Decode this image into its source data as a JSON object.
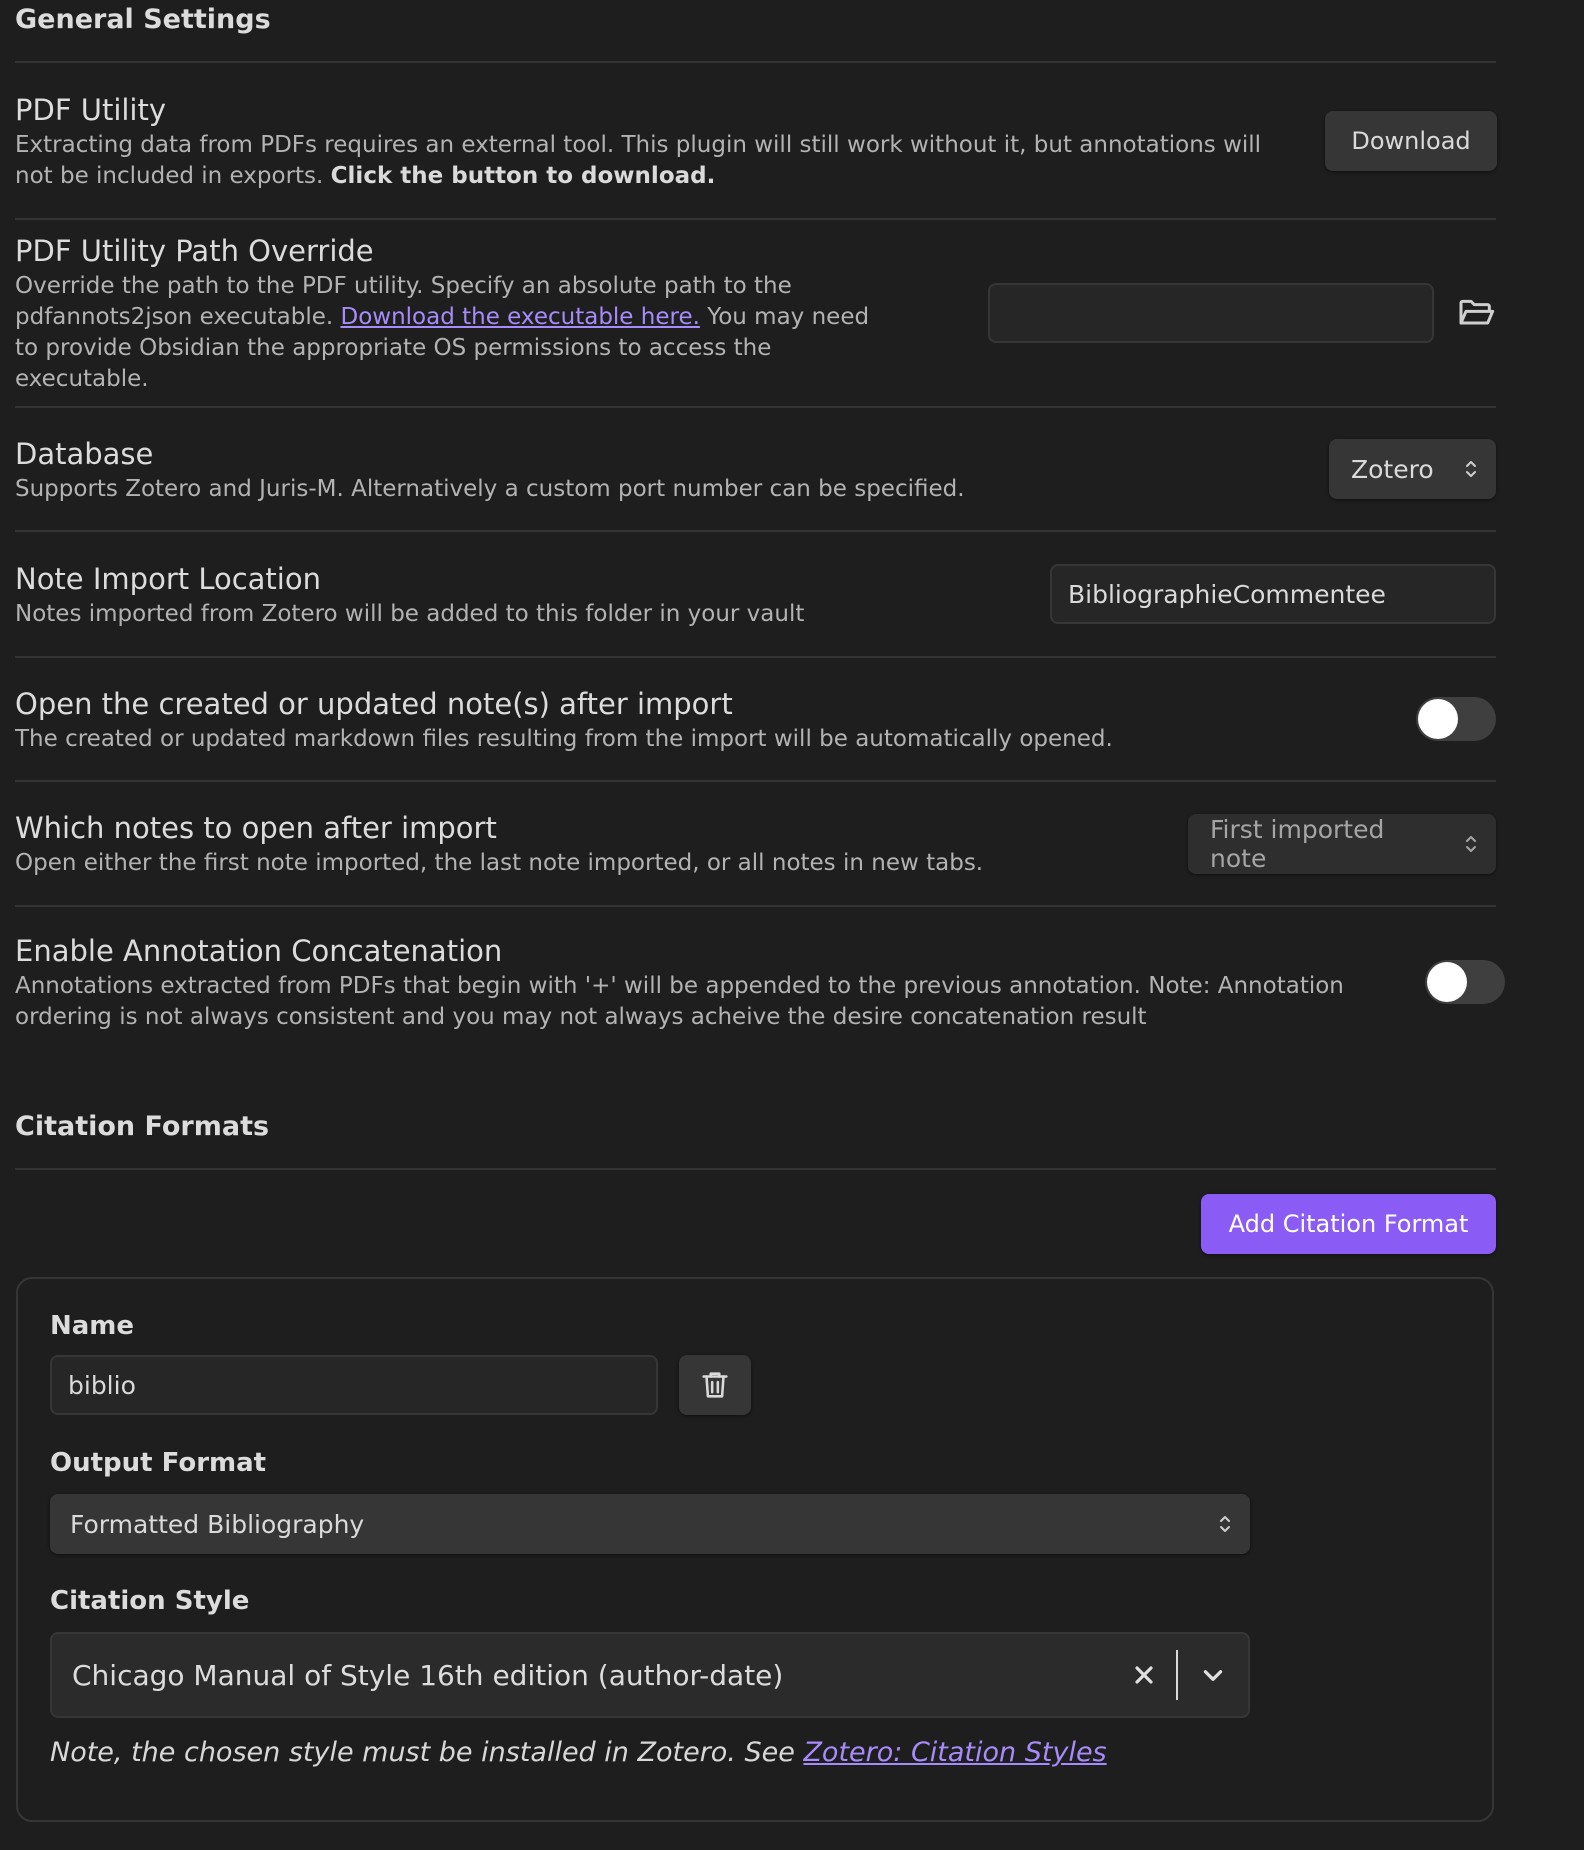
{
  "general": {
    "heading": "General Settings"
  },
  "settings": {
    "pdf_utility": {
      "name": "PDF Utility",
      "desc": "Extracting data from PDFs requires an external tool. This plugin will still work without it, but annotations will not be included in exports.",
      "desc_bold": "Click the button to download.",
      "button": "Download"
    },
    "path_override": {
      "name": "PDF Utility Path Override",
      "desc_pre": "Override the path to the PDF utility. Specify an absolute path to the pdfannots2json executable.",
      "link": "Download the executable here.",
      "desc_post": "You may need to provide Obsidian the appropriate OS permissions to access the executable.",
      "value": ""
    },
    "database": {
      "name": "Database",
      "desc": "Supports Zotero and Juris-M. Alternatively a custom port number can be specified.",
      "selected": "Zotero"
    },
    "import_location": {
      "name": "Note Import Location",
      "desc": "Notes imported from Zotero will be added to this folder in your vault",
      "value": "BibliographieCommentee"
    },
    "open_after_import": {
      "name": "Open the created or updated note(s) after import",
      "desc": "The created or updated markdown files resulting from the import will be automatically opened.",
      "enabled": false
    },
    "which_notes": {
      "name": "Which notes to open after import",
      "desc": "Open either the first note imported, the last note imported, or all notes in new tabs.",
      "selected": "First imported note"
    },
    "concatenation": {
      "name": "Enable Annotation Concatenation",
      "desc": "Annotations extracted from PDFs that begin with '+' will be appended to the previous annotation. Note: Annotation ordering is not always consistent and you may not always acheive the desire concatenation result",
      "enabled": false
    }
  },
  "citation": {
    "heading": "Citation Formats",
    "add_button": "Add Citation Format",
    "card": {
      "name_label": "Name",
      "name_value": "biblio",
      "output_label": "Output Format",
      "output_selected": "Formatted Bibliography",
      "style_label": "Citation Style",
      "style_selected": "Chicago Manual of Style 16th edition (author-date)",
      "note_text": "Note, the chosen style must be installed in Zotero. See",
      "note_link": "Zotero: Citation Styles"
    }
  },
  "icons": {
    "folder": "folder-open-icon",
    "trash": "trash-icon",
    "chevron_updown": "chevron-up-down-icon",
    "clear": "close-icon",
    "chevron_down": "chevron-down-icon"
  },
  "colors": {
    "background": "#1e1e1e",
    "accent": "#8a5cf5",
    "link": "#a88bfa"
  }
}
